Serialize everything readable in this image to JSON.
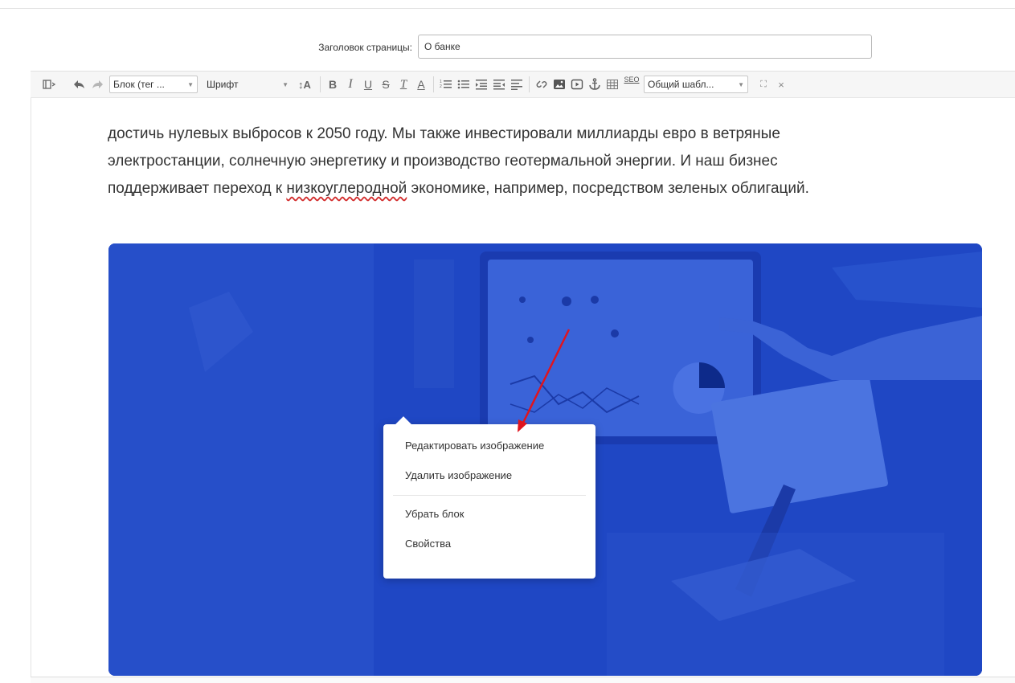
{
  "page_title": {
    "label": "Заголовок страницы:",
    "value": "О банке"
  },
  "toolbar": {
    "block_select": "Блок (тег ...",
    "font_select": "Шрифт",
    "template_select": "Общий шабл...",
    "seo_label": "SEO",
    "icons": [
      "blocks-icon",
      "undo-icon",
      "redo-icon",
      "font-size-icon",
      "bold-icon",
      "italic-icon",
      "underline-icon",
      "strikethrough-icon",
      "clear-format-icon",
      "text-color-icon",
      "ordered-list-icon",
      "bullet-list-icon",
      "indent-icon",
      "outdent-icon",
      "align-icon",
      "link-icon",
      "image-icon",
      "video-icon",
      "anchor-icon",
      "table-icon",
      "seo-icon",
      "fullscreen-icon",
      "close-icon"
    ]
  },
  "content": {
    "lines": [
      "достичь нулевых выбросов к 2050 году. Мы также инвестировали миллиарды евро в ветряные",
      "электростанции, солнечную энергетику и производство геотермальной энергии. И наш бизнес"
    ],
    "line3_before": "поддерживает переход к ",
    "line3_marked": "низкоуглеродной",
    "line3_after": " экономике, например, посредством зеленых облигаций."
  },
  "image": {
    "tint": "#2b55cf"
  },
  "context_menu": {
    "edit": "Редактировать изображение",
    "delete": "Удалить изображение",
    "remove_block": "Убрать блок",
    "properties": "Свойства"
  },
  "colors": {
    "annotation_arrow": "#e0141e",
    "spellcheck": "#d32f2f"
  }
}
